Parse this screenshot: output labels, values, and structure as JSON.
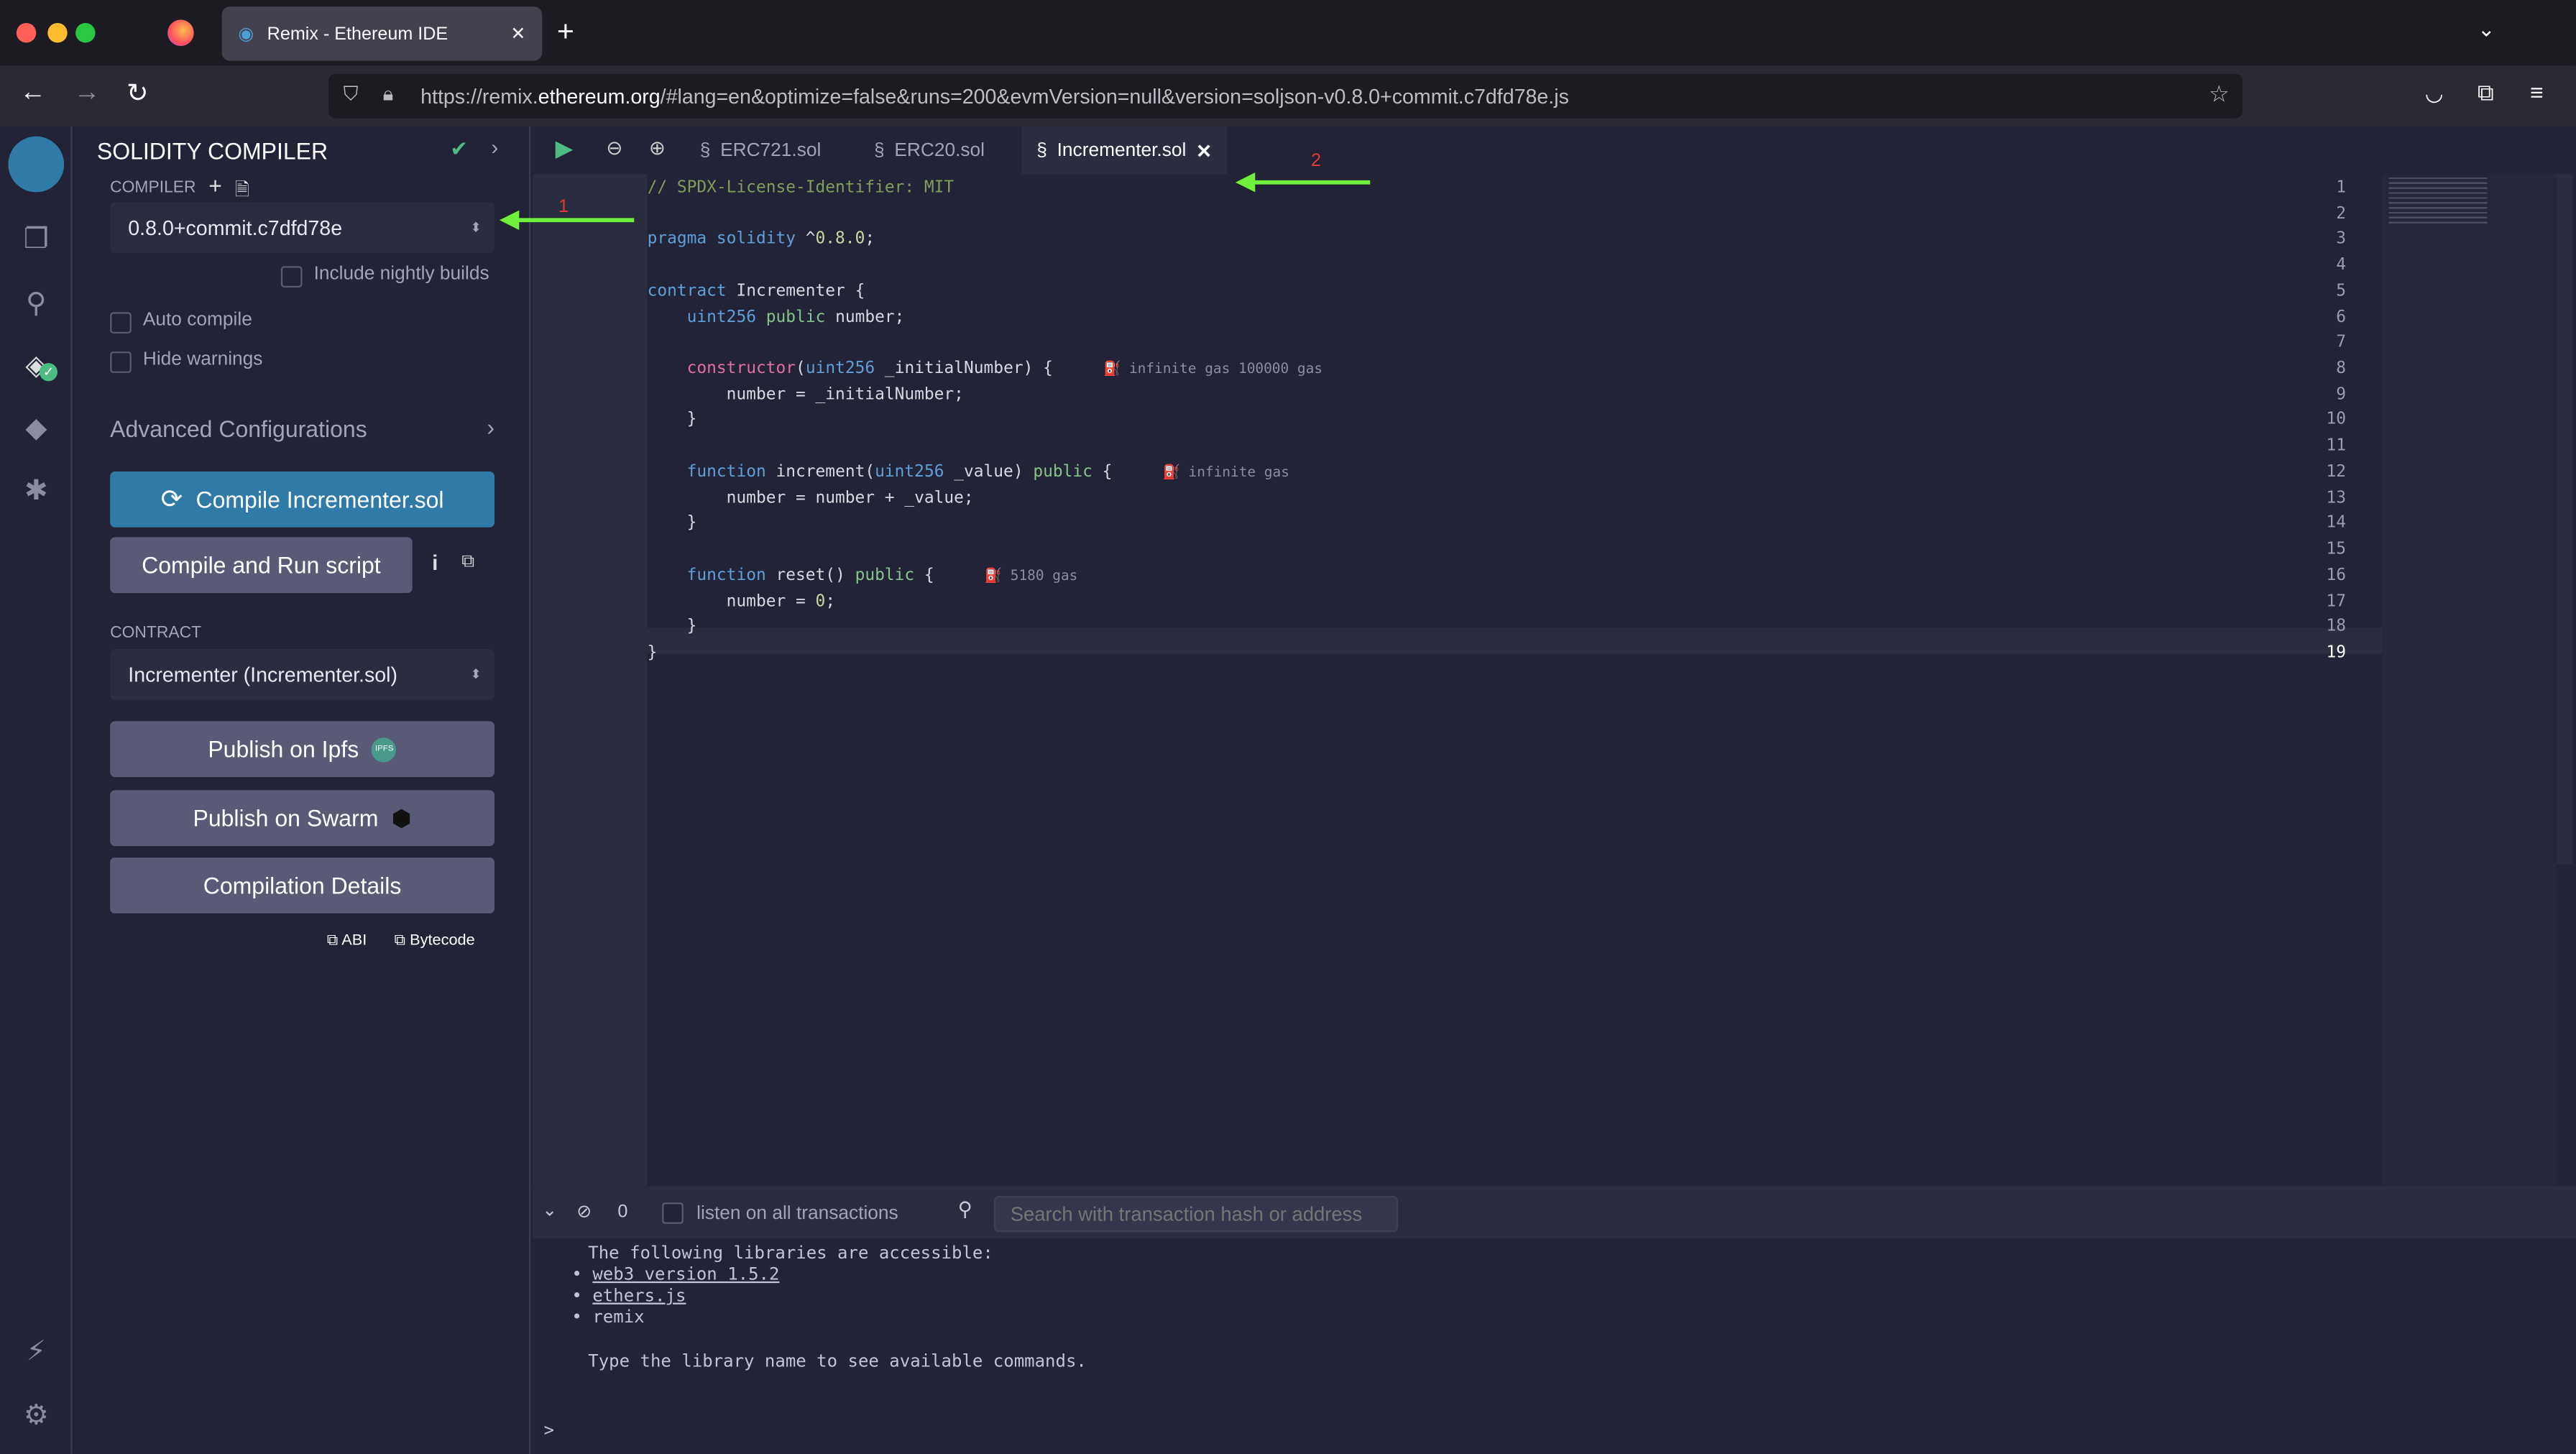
{
  "browser": {
    "tab_title": "Remix - Ethereum IDE",
    "url_prefix": "https://remix.",
    "url_domain": "ethereum.org",
    "url_suffix": "/#lang=en&optimize=false&runs=200&evmVersion=null&version=soljson-v0.8.0+commit.c7dfd78e.js"
  },
  "side": {
    "title": "SOLIDITY COMPILER",
    "compiler_label": "COMPILER",
    "compiler_version": "0.8.0+commit.c7dfd78e",
    "nightly": "Include nightly builds",
    "auto_compile": "Auto compile",
    "hide_warnings": "Hide warnings",
    "advanced": "Advanced Configurations",
    "compile_btn": "Compile Incrementer.sol",
    "run_script_btn": "Compile and Run script",
    "contract_label": "CONTRACT",
    "contract": "Incrementer (Incrementer.sol)",
    "publish_ipfs": "Publish on Ipfs",
    "ipfs_badge": "IPFS",
    "publish_swarm": "Publish on Swarm",
    "details": "Compilation Details",
    "abi": "ABI",
    "bytecode": "Bytecode"
  },
  "editor": {
    "tabs": [
      {
        "label": "ERC721.sol"
      },
      {
        "label": "ERC20.sol"
      },
      {
        "label": "Incrementer.sol",
        "active": true
      }
    ],
    "lines": [
      [
        [
          "// SPDX-License-Identifier: MIT",
          "cm"
        ]
      ],
      [],
      [
        [
          "pragma solidity",
          "kw"
        ],
        [
          " ^",
          ""
        ],
        [
          "0.8.0",
          "num"
        ],
        [
          ";",
          ""
        ]
      ],
      [],
      [
        [
          "contract",
          "kw"
        ],
        [
          " Incrementer {",
          ""
        ]
      ],
      [
        [
          "    ",
          ""
        ],
        [
          "uint256",
          "kw"
        ],
        [
          " ",
          ""
        ],
        [
          "public",
          "pub"
        ],
        [
          " number;",
          ""
        ]
      ],
      [],
      [
        [
          "    ",
          ""
        ],
        [
          "constructor",
          "ctor"
        ],
        [
          "(",
          ""
        ],
        [
          "uint256",
          "kw"
        ],
        [
          " _initialNumber) {",
          ""
        ]
      ],
      [
        [
          "        number = _initialNumber;",
          ""
        ]
      ],
      [
        [
          "    }",
          ""
        ]
      ],
      [],
      [
        [
          "    ",
          ""
        ],
        [
          "function",
          "kw"
        ],
        [
          " increment(",
          ""
        ],
        [
          "uint256",
          "kw"
        ],
        [
          " _value) ",
          ""
        ],
        [
          "public",
          "pub"
        ],
        [
          " {",
          ""
        ]
      ],
      [
        [
          "        number = number + _value;",
          ""
        ]
      ],
      [
        [
          "    }",
          ""
        ]
      ],
      [],
      [
        [
          "    ",
          ""
        ],
        [
          "function",
          "kw"
        ],
        [
          " reset() ",
          ""
        ],
        [
          "public",
          "pub"
        ],
        [
          " {",
          ""
        ]
      ],
      [
        [
          "        number = ",
          ""
        ],
        [
          "0",
          "num"
        ],
        [
          ";",
          ""
        ]
      ],
      [
        [
          "    }",
          ""
        ]
      ],
      [
        [
          "}",
          ""
        ]
      ]
    ],
    "gas": [
      {
        "line": 8,
        "text": "infinite gas 100000 gas"
      },
      {
        "line": 12,
        "text": "infinite gas"
      },
      {
        "line": 16,
        "text": "5180 gas"
      }
    ]
  },
  "terminal": {
    "count": "0",
    "listen": "listen on all transactions",
    "search_placeholder": "Search with transaction hash or address",
    "intro": "The following libraries are accessible:",
    "libs": [
      "web3 version 1.5.2",
      "ethers.js",
      "remix"
    ],
    "hint": "Type the library name to see available commands.",
    "prompt": ">"
  },
  "annotations": {
    "one": "1",
    "two": "2"
  },
  "colors": {
    "accent": "#2f7aa6",
    "arrow": "#6ef03c",
    "marker": "#e53935",
    "success": "#4cbb84"
  }
}
